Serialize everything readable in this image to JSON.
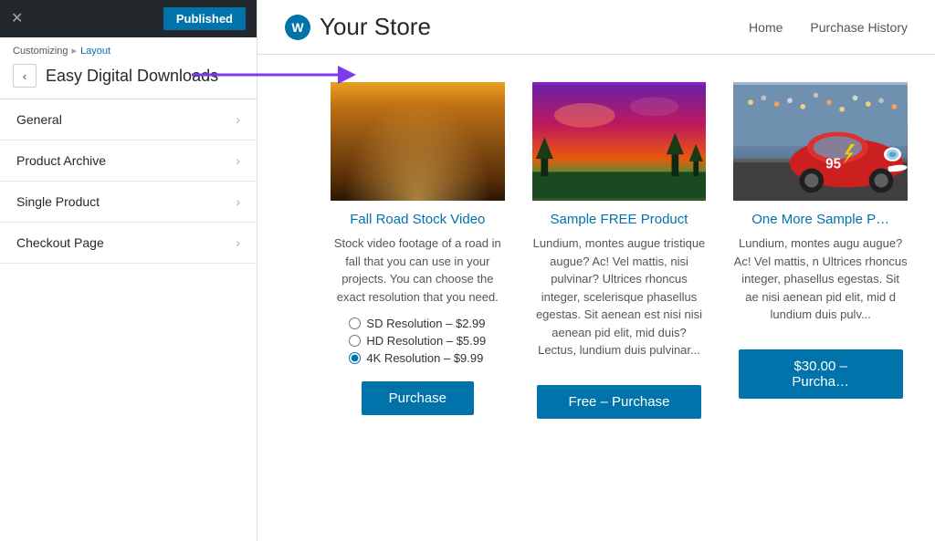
{
  "sidebar": {
    "close_label": "✕",
    "published_label": "Published",
    "customizing_label": "Customizing",
    "breadcrumb_separator": "▸",
    "breadcrumb_link": "Layout",
    "back_arrow": "‹",
    "section_title": "Easy Digital Downloads",
    "nav_items": [
      {
        "id": "general",
        "label": "General"
      },
      {
        "id": "product-archive",
        "label": "Product Archive"
      },
      {
        "id": "single-product",
        "label": "Single Product"
      },
      {
        "id": "checkout-page",
        "label": "Checkout Page"
      }
    ],
    "chevron": "›"
  },
  "store": {
    "logo_text": "W",
    "name": "Your Store",
    "nav_items": [
      {
        "label": "Home"
      },
      {
        "label": "Purchase History"
      }
    ]
  },
  "products": [
    {
      "id": "fall-road",
      "title": "Fall Road Stock Video",
      "description": "Stock video footage of a road in fall that you can use in your projects. You can choose the exact resolution that you need.",
      "radio_options": [
        {
          "label": "SD Resolution – $2.99",
          "checked": false
        },
        {
          "label": "HD Resolution – $5.99",
          "checked": false
        },
        {
          "label": "4K Resolution – $9.99",
          "checked": true
        }
      ],
      "button_label": "Purchase"
    },
    {
      "id": "sample-free",
      "title": "Sample FREE Product",
      "description": "Lundium, montes augue tristique augue? Ac! Vel mattis, nisi pulvinar? Ultrices rhoncus integer, scelerisque phasellus egestas. Sit aenean est nisi nisi aenean pid elit, mid duis? Lectus, lundium duis pulvinar...",
      "button_label": "Free – Purchase"
    },
    {
      "id": "one-more-sample",
      "title": "One More Sample P…",
      "description": "Lundium, montes augu augue? Ac! Vel mattis, n Ultrices rhoncus integer, phasellus egestas. Sit ae nisi aenean pid elit, mid d lundium duis pulv...",
      "button_label": "$30.00 – Purcha…"
    }
  ],
  "arrow": {
    "color": "#7c3aed"
  }
}
